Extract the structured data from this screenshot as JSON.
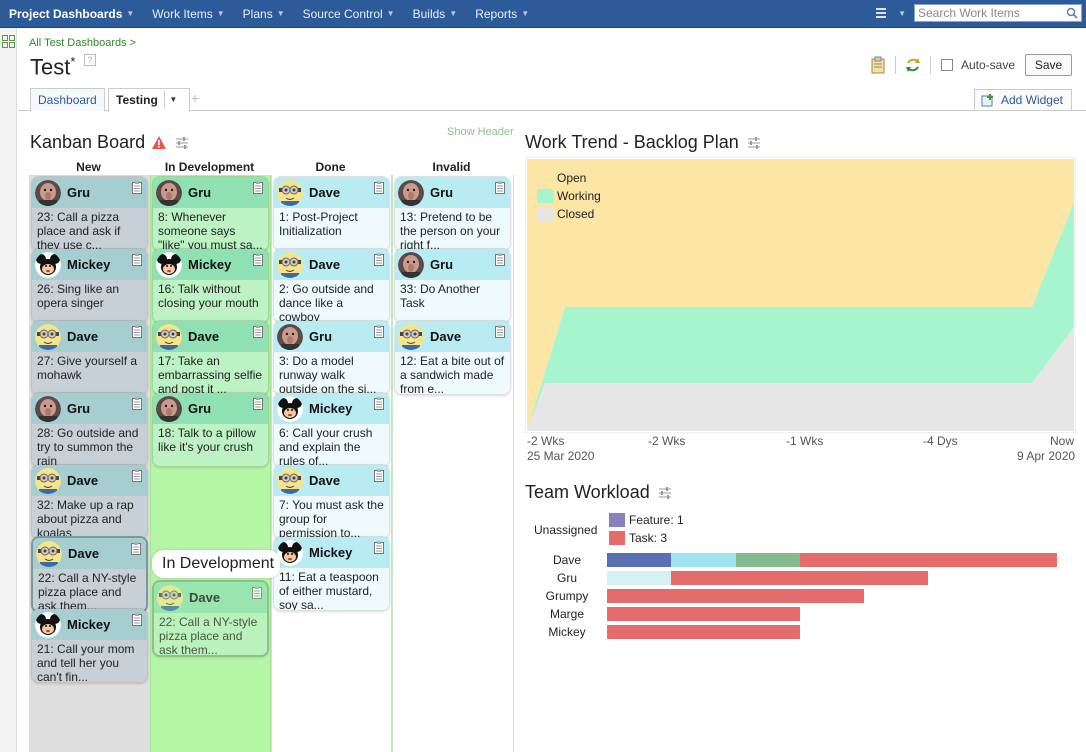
{
  "nav": {
    "items": [
      "Project Dashboards",
      "Work Items",
      "Plans",
      "Source Control",
      "Builds",
      "Reports"
    ],
    "search_placeholder": "Search Work Items"
  },
  "header": {
    "breadcrumb": "All Test Dashboards >",
    "title": "Test",
    "modified_marker": "*",
    "help": "?",
    "autosave_label": "Auto-save",
    "save_label": "Save"
  },
  "tabs": {
    "items": [
      "Dashboard",
      "Testing"
    ],
    "add_widget": "Add Widget"
  },
  "kanban": {
    "title": "Kanban Board",
    "show_header": "Show Header",
    "columns": [
      "New",
      "In Development",
      "Done",
      "Invalid"
    ],
    "drag_label": "In Development",
    "cards": {
      "new": [
        {
          "owner": "Gru",
          "text": "23: Call a pizza place and ask if they use c..."
        },
        {
          "owner": "Mickey",
          "text": "26: Sing like an opera singer"
        },
        {
          "owner": "Dave",
          "text": "27: Give yourself a mohawk"
        },
        {
          "owner": "Gru",
          "text": "28: Go outside and try to summon the rain"
        },
        {
          "owner": "Dave",
          "text": "32: Make up a rap about pizza and koalas"
        },
        {
          "owner": "Dave",
          "text": "22: Call a NY-style pizza place and ask them..."
        },
        {
          "owner": "Mickey",
          "text": "21: Call your mom and tell her you can't fin..."
        }
      ],
      "dev": [
        {
          "owner": "Gru",
          "text": "8: Whenever someone says \"like\" you must sa..."
        },
        {
          "owner": "Mickey",
          "text": "16: Talk without closing your mouth"
        },
        {
          "owner": "Dave",
          "text": "17: Take an embarrassing selfie and post it ..."
        },
        {
          "owner": "Gru",
          "text": "18: Talk to a pillow like it's your crush"
        },
        {
          "owner": "Dave",
          "text": "22: Call a NY-style pizza place and ask them..."
        }
      ],
      "done": [
        {
          "owner": "Dave",
          "text": "1: Post-Project Initialization"
        },
        {
          "owner": "Dave",
          "text": "2: Go outside and dance like a cowboy"
        },
        {
          "owner": "Gru",
          "text": "3: Do a model runway walk outside on the si..."
        },
        {
          "owner": "Mickey",
          "text": "6: Call your crush and explain the rules of..."
        },
        {
          "owner": "Dave",
          "text": "7: You must ask the group for permission to..."
        },
        {
          "owner": "Mickey",
          "text": "11: Eat a teaspoon of either mustard, soy sa..."
        }
      ],
      "invalid": [
        {
          "owner": "Gru",
          "text": "13: Pretend to be the person on your right f..."
        },
        {
          "owner": "Gru",
          "text": "33: Do Another Task"
        },
        {
          "owner": "Dave",
          "text": "12: Eat a bite out of a sandwich made from e..."
        }
      ]
    }
  },
  "work_trend": {
    "title": "Work Trend - Backlog Plan",
    "legend": [
      "Open",
      "Working",
      "Closed"
    ],
    "colors": {
      "open": "#fbe6a6",
      "working": "#a6f5cf",
      "closed": "#e6e6e6"
    },
    "x_ticks": [
      "-2 Wks",
      "-2 Wks",
      "-1 Wks",
      "-4 Dys",
      "Now"
    ],
    "date_start": "25 Mar 2020",
    "date_end": "9 Apr 2020"
  },
  "team_workload": {
    "title": "Team Workload",
    "unassigned_label": "Unassigned",
    "unassigned": [
      "Feature: 1",
      "Task: 3"
    ],
    "unassigned_colors": [
      "#8a80bf",
      "#e46c6c"
    ],
    "people": [
      "Dave",
      "Gru",
      "Grumpy",
      "Marge",
      "Mickey"
    ]
  },
  "chart_data": {
    "type": "area",
    "title": "Work Trend - Backlog Plan",
    "x": [
      "25 Mar 2020",
      "9 Apr 2020"
    ],
    "series": [
      {
        "name": "Closed",
        "values": [
          0,
          0
        ]
      },
      {
        "name": "Working",
        "values": [
          1,
          1
        ]
      },
      {
        "name": "Open",
        "values": [
          2,
          2
        ]
      }
    ]
  }
}
